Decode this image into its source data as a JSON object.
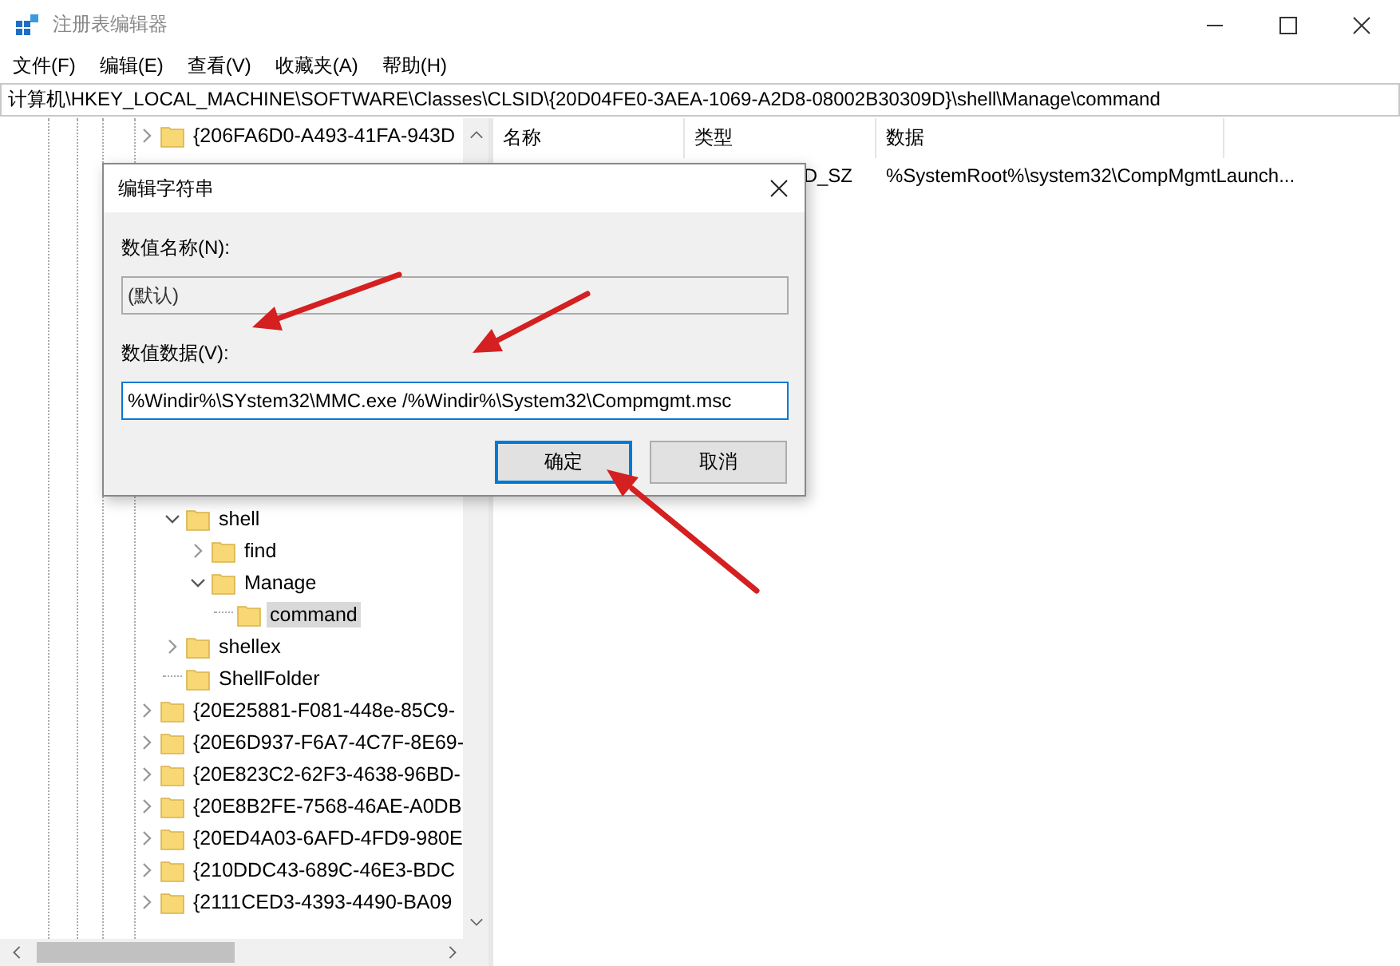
{
  "window": {
    "title": "注册表编辑器"
  },
  "menu": [
    "文件(F)",
    "编辑(E)",
    "查看(V)",
    "收藏夹(A)",
    "帮助(H)"
  ],
  "address": "计算机\\HKEY_LOCAL_MACHINE\\SOFTWARE\\Classes\\CLSID\\{20D04FE0-3AEA-1069-A2D8-08002B30309D}\\shell\\Manage\\command",
  "tree": {
    "top": [
      {
        "label": "{206FA6D0-A493-41FA-943D",
        "expanded": false,
        "selected": false
      }
    ],
    "branch": [
      {
        "label": "shell",
        "expanded": true,
        "selected": false,
        "children": [
          {
            "label": "find",
            "expanded": false,
            "selected": false
          },
          {
            "label": "Manage",
            "expanded": true,
            "selected": false,
            "children": [
              {
                "label": "command",
                "selected": true
              }
            ]
          }
        ]
      },
      {
        "label": "shellex",
        "expanded": false,
        "selected": false
      },
      {
        "label": "ShellFolder",
        "selected": false
      }
    ],
    "bottom": [
      {
        "label": "{20E25881-F081-448e-85C9-",
        "expanded": false,
        "selected": false
      },
      {
        "label": "{20E6D937-F6A7-4C7F-8E69-",
        "expanded": false,
        "selected": false
      },
      {
        "label": "{20E823C2-62F3-4638-96BD-",
        "expanded": false,
        "selected": false
      },
      {
        "label": "{20E8B2FE-7568-46AE-A0DB",
        "expanded": false,
        "selected": false
      },
      {
        "label": "{20ED4A03-6AFD-4FD9-980E",
        "expanded": false,
        "selected": false
      },
      {
        "label": "{210DDC43-689C-46E3-BDC",
        "expanded": false,
        "selected": false
      },
      {
        "label": "{2111CED3-4393-4490-BA09",
        "expanded": false,
        "selected": false
      }
    ]
  },
  "values": {
    "columns": [
      "名称",
      "类型",
      "数据"
    ],
    "rows": [
      {
        "type": "D_SZ",
        "data": "%SystemRoot%\\system32\\CompMgmtLaunch..."
      }
    ]
  },
  "dialog": {
    "title": "编辑字符串",
    "name_label": "数值名称(N):",
    "name_value": "(默认)",
    "data_label": "数值数据(V):",
    "data_value": "%Windir%\\SYstem32\\MMC.exe /%Windir%\\System32\\Compmgmt.msc",
    "buttons": [
      {
        "label": "确定",
        "kind": "default"
      },
      {
        "label": "取消",
        "kind": "normal"
      }
    ]
  }
}
